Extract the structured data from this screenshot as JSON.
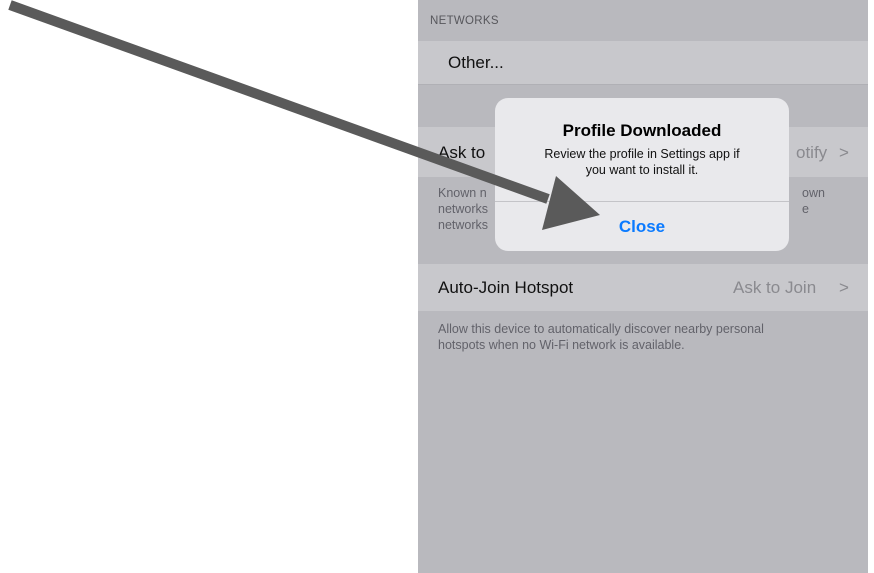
{
  "networks": {
    "header": "NETWORKS",
    "other_label": "Other..."
  },
  "ask_to_join": {
    "label_visible": "Ask to",
    "value_visible": "otify",
    "footer_left_lines": [
      "Known n",
      "networks",
      "networks"
    ],
    "footer_right_lines": [
      "own",
      "e"
    ]
  },
  "auto_join_hotspot": {
    "label": "Auto-Join Hotspot",
    "value": "Ask to Join",
    "footer_lines": [
      "Allow this device to automatically discover nearby personal",
      "hotspots when no Wi-Fi network is available."
    ]
  },
  "alert": {
    "title": "Profile Downloaded",
    "message_lines": [
      "Review the profile in Settings app if",
      "you want to install it."
    ],
    "button_label": "Close"
  },
  "icons": {
    "chevron": ">",
    "annotation_arrow": "arrow-pointer-icon"
  },
  "colors": {
    "screen_background": "#b9b9be",
    "cell_background": "#c8c8cc",
    "alert_background": "#e9e9ec",
    "alert_button": "#0a7aff",
    "arrow": "#5a5a5a"
  }
}
